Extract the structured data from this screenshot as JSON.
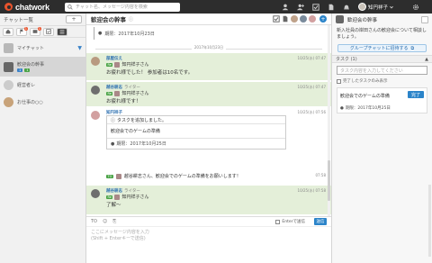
{
  "topbar": {
    "logo": "chatwork",
    "search_placeholder": "チャット名、メッセージ内容を検索",
    "user_name": "知円祥子"
  },
  "sidebar": {
    "header": "チャット一覧",
    "add_label": "+",
    "chats": [
      {
        "name": "マイチャット"
      },
      {
        "name": "歓迎会の幹事",
        "badge1": "1",
        "badge2": "1"
      },
      {
        "name": "経営者レ"
      },
      {
        "name": "お仕事の○○"
      }
    ]
  },
  "room": {
    "title": "歓迎会の幹事",
    "quote_text": "期限：2017年10月23日",
    "date_separator": "2017年10月23日",
    "messages": [
      {
        "sender": "部屋伝え",
        "role": "",
        "to": "知円祥子さん",
        "body": "お疲れ様でした！ 参加者は10名です。",
        "time": "10/25(水) 07:47"
      },
      {
        "sender": "越谷耕志",
        "role": "ライター",
        "to": "知円祥子さん",
        "body": "お疲れ様です！",
        "time": "10/25(水) 07:47"
      },
      {
        "sender": "知円祥子",
        "role": "",
        "time": "10/25(水) 07:56"
      },
      {
        "sender": "越谷耕志",
        "role": "ライター",
        "to": "知円祥子さん",
        "body": "了解〜",
        "time": "10/25(水) 07:58"
      }
    ],
    "task_card": {
      "header": "タスクを追加しました。",
      "task": "歓迎会でのゲームの準備",
      "deadline": "期限：2017年10月25日"
    },
    "system_line": "越谷耕志さん、歓迎会でのゲームの準備をお願いします！",
    "system_time": "07:58"
  },
  "compose": {
    "placeholder_1": "ここにメッセージ内容を入力",
    "placeholder_2": "(Shift + Enterキーで送信)",
    "enter_label": "Enterで送信",
    "send_label": "送信"
  },
  "right_panel": {
    "title": "歓迎会の幹事",
    "description": "新入社員の岸田さんの歓迎会について相談しましょう。",
    "group_button": "グループチャットに招待する",
    "task_section": "タスク (1)",
    "task_input_placeholder": "タスク内容を入力してください",
    "show_done": "完了したタスクのみ表示",
    "task_name": "歓迎会でのゲームの準備",
    "task_deadline": "期限：2017年10月25日",
    "done_label": "完了"
  },
  "colors": {
    "topbar": "#2d2d2d",
    "accent": "#2b84c9",
    "logo": "#e8532d",
    "message_highlight": "#e4efd9"
  }
}
